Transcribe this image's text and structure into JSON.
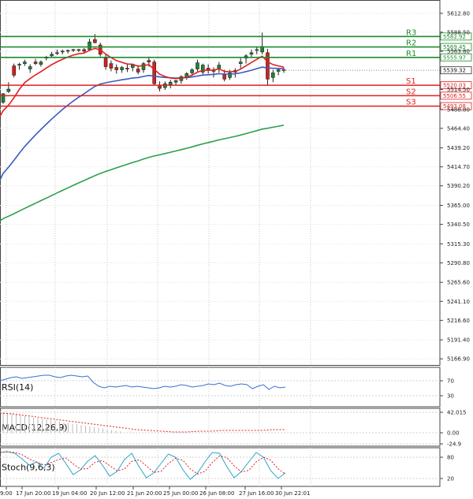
{
  "chart_data": {
    "type": "candlestick",
    "y_ticks": [
      "5612.80",
      "5588.50",
      "5563.80",
      "5539.32",
      "5514.50",
      "5488.80",
      "5464.40",
      "5439.20",
      "5414.70",
      "5390.20",
      "5365.00",
      "5340.50",
      "5315.30",
      "5290.80",
      "5265.60",
      "5241.10",
      "5216.60",
      "5191.40",
      "5166.90"
    ],
    "ylim": [
      5160,
      5628
    ],
    "x_labels": [
      "9:00",
      "17 Jun 20:00",
      "19 Jun 04:00",
      "20 Jun 12:00",
      "21 Jun 20:00",
      "25 Jun 00:00",
      "26 Jun 08:00",
      "27 Jun 16:00",
      "30 Jun 22:01"
    ],
    "current_price": "5539.32",
    "levels": [
      {
        "label": "R3",
        "value": 5582.92,
        "tag": "5582.92",
        "color": "#1f8c2e"
      },
      {
        "label": "R2",
        "value": 5569.45,
        "tag": "5569.45",
        "color": "#1f8c2e"
      },
      {
        "label": "R1",
        "value": 5555.97,
        "tag": "5555.97",
        "color": "#1f8c2e"
      },
      {
        "label": "S1",
        "value": 5520.03,
        "tag": "5520.03",
        "color": "#e02020"
      },
      {
        "label": "S2",
        "value": 5506.55,
        "tag": "5506.55",
        "color": "#e02020"
      },
      {
        "label": "S3",
        "value": 5493.08,
        "tag": "5493.08",
        "color": "#e02020"
      }
    ],
    "candles": [
      [
        5498,
        5510,
        5496,
        5509
      ],
      [
        5512,
        5524,
        5510,
        5515
      ],
      [
        5545,
        5548,
        5530,
        5533
      ],
      [
        5546,
        5549,
        5540,
        5547
      ],
      [
        5548,
        5553,
        5545,
        5550
      ],
      [
        5541,
        5547,
        5536,
        5544
      ],
      [
        5550,
        5554,
        5546,
        5548
      ],
      [
        5547,
        5552,
        5544,
        5550
      ],
      [
        5555,
        5558,
        5552,
        5556
      ],
      [
        5558,
        5563,
        5556,
        5560
      ],
      [
        5562,
        5566,
        5559,
        5561
      ],
      [
        5563,
        5566,
        5560,
        5564
      ],
      [
        5564,
        5566,
        5561,
        5565
      ],
      [
        5565,
        5567,
        5563,
        5566
      ],
      [
        5565,
        5567,
        5563,
        5566
      ],
      [
        5566,
        5568,
        5562,
        5564
      ],
      [
        5566,
        5580,
        5564,
        5576
      ],
      [
        5579,
        5586,
        5574,
        5575
      ],
      [
        5572,
        5575,
        5557,
        5560
      ],
      [
        5555,
        5560,
        5540,
        5544
      ],
      [
        5548,
        5552,
        5538,
        5542
      ],
      [
        5543,
        5547,
        5535,
        5540
      ],
      [
        5540,
        5545,
        5536,
        5543
      ],
      [
        5542,
        5547,
        5537,
        5541
      ],
      [
        5543,
        5548,
        5538,
        5546
      ],
      [
        5541,
        5546,
        5534,
        5537
      ],
      [
        5540,
        5550,
        5536,
        5548
      ],
      [
        5552,
        5557,
        5544,
        5550
      ],
      [
        5550,
        5553,
        5520,
        5522
      ],
      [
        5520,
        5525,
        5512,
        5516
      ],
      [
        5517,
        5525,
        5514,
        5522
      ],
      [
        5521,
        5527,
        5516,
        5524
      ],
      [
        5524,
        5527,
        5520,
        5526
      ],
      [
        5526,
        5533,
        5522,
        5531
      ],
      [
        5530,
        5537,
        5527,
        5535
      ],
      [
        5536,
        5542,
        5532,
        5540
      ],
      [
        5541,
        5553,
        5538,
        5549
      ],
      [
        5537,
        5548,
        5534,
        5546
      ],
      [
        5542,
        5547,
        5535,
        5540
      ],
      [
        5538,
        5543,
        5530,
        5540
      ],
      [
        5542,
        5550,
        5536,
        5546
      ],
      [
        5534,
        5540,
        5525,
        5528
      ],
      [
        5530,
        5540,
        5527,
        5536
      ],
      [
        5537,
        5542,
        5530,
        5539
      ],
      [
        5548,
        5555,
        5542,
        5550
      ],
      [
        5555,
        5560,
        5548,
        5558
      ],
      [
        5560,
        5566,
        5555,
        5562
      ],
      [
        5565,
        5569,
        5560,
        5566
      ],
      [
        5563,
        5588,
        5560,
        5570
      ],
      [
        5562,
        5567,
        5520,
        5528
      ],
      [
        5530,
        5540,
        5524,
        5536
      ],
      [
        5538,
        5542,
        5533,
        5540
      ],
      [
        5540,
        5543,
        5536,
        5539
      ]
    ],
    "indicators": [
      {
        "name": "RSI(14)",
        "ticks": [
          "70",
          "30"
        ]
      },
      {
        "name": "MACD(12,26,9)",
        "ticks": [
          "42.015",
          "0.00",
          "-24.9"
        ]
      },
      {
        "name": "Stoch(9,6,3)",
        "ticks": [
          "80",
          "20"
        ]
      }
    ]
  }
}
